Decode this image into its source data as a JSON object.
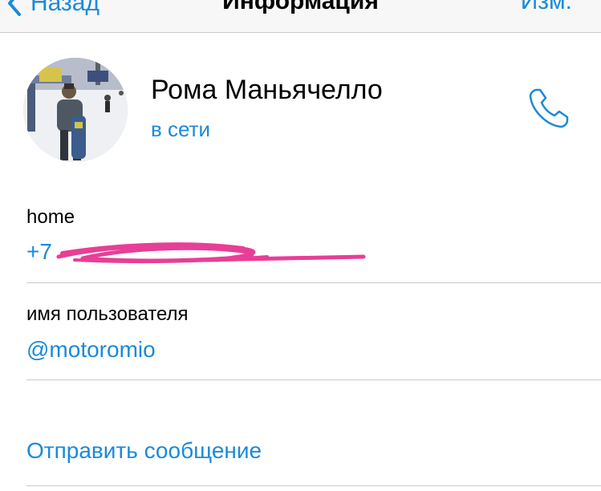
{
  "navbar": {
    "back_label": "Назад",
    "title": "Информация",
    "edit_label": "Изм."
  },
  "profile": {
    "name": "Рома Маньячелло",
    "status": "в сети"
  },
  "phone": {
    "label": "home",
    "value": "+7"
  },
  "username": {
    "label": "имя пользователя",
    "value": "@motoromio"
  },
  "actions": {
    "send_message": "Отправить сообщение"
  },
  "colors": {
    "accent": "#1a8ad8",
    "redaction": "#e83e97",
    "separator": "#c8c7cc"
  },
  "icons": {
    "back": "chevron-left-icon",
    "call": "phone-icon"
  }
}
